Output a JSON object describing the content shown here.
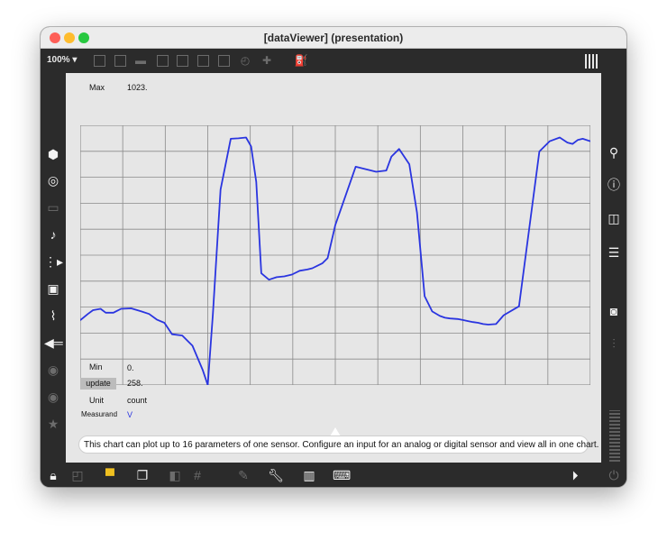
{
  "window": {
    "title": "[dataViewer] (presentation)"
  },
  "toolbar": {
    "zoom_label": "100% ▾"
  },
  "chart": {
    "max_label": "Max",
    "max_value": "1023.",
    "min_label": "Min",
    "min_value": "0.",
    "update_label": "update",
    "current_value": "258.",
    "unit_label": "Unit",
    "unit_value": "count",
    "measurand_label": "Measurand",
    "measurand_value": "V"
  },
  "info": {
    "text": "This chart can plot up to 16 parameters of one sensor. Configure an input for an analog or digital sensor and view all in one chart."
  },
  "chart_data": {
    "type": "line",
    "ylim": [
      0,
      1023
    ],
    "xlim": [
      0,
      100
    ],
    "grid": true,
    "line_color": "#2a35e0",
    "series": [
      {
        "x": [
          0,
          1.5,
          2.5,
          4,
          5,
          6.5,
          8,
          10,
          12,
          13.5,
          15,
          16.5,
          18,
          20,
          22,
          24,
          25,
          26,
          27.5,
          29.5,
          31,
          32.5,
          33.5,
          34.5,
          35.5,
          37,
          38.5,
          40,
          41.5,
          43,
          44.5,
          45.5,
          46.5,
          47.5,
          48.5,
          50,
          54,
          58,
          60,
          61,
          62.5,
          63.5,
          64.5,
          66,
          67.5,
          69,
          70.5,
          71.5,
          72.5,
          74,
          75,
          76,
          77,
          78,
          79,
          80,
          81.5,
          83,
          86,
          90,
          92,
          94,
          95.5,
          96.5,
          97.5,
          98.5,
          100
        ],
        "y": [
          255,
          280,
          295,
          300,
          285,
          285,
          300,
          302,
          290,
          280,
          258,
          245,
          200,
          195,
          155,
          60,
          0,
          280,
          770,
          970,
          972,
          975,
          940,
          800,
          440,
          415,
          425,
          428,
          435,
          450,
          455,
          460,
          470,
          480,
          500,
          630,
          860,
          840,
          845,
          900,
          930,
          900,
          870,
          680,
          350,
          290,
          272,
          265,
          262,
          260,
          256,
          252,
          248,
          245,
          240,
          238,
          240,
          275,
          310,
          920,
          960,
          975,
          955,
          950,
          965,
          970,
          960
        ]
      }
    ]
  }
}
